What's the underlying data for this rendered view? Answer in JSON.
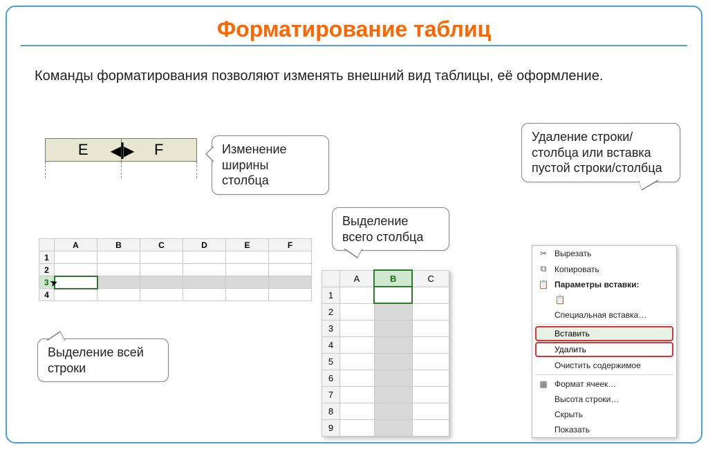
{
  "title": "Форматирование таблиц",
  "intro": "Команды форматирования позволяют изменять внешний вид таблицы, её оформление.",
  "callouts": {
    "width": "Изменение ширины столбца",
    "row": "Выделение всей строки",
    "col": "Выделение всего столбца",
    "del": "Удаление строки/столбца или вставка пустой строки/столбца"
  },
  "fig1": {
    "colE": "E",
    "colF": "F"
  },
  "fig2": {
    "cols": [
      "A",
      "B",
      "C",
      "D",
      "E",
      "F"
    ],
    "rows": [
      "1",
      "2",
      "3",
      "4"
    ],
    "selectedRow": "3"
  },
  "fig3": {
    "cols": [
      "A",
      "B",
      "C"
    ],
    "rows": [
      "1",
      "2",
      "3",
      "4",
      "5",
      "6",
      "7",
      "8",
      "9"
    ],
    "selectedCol": "B"
  },
  "contextMenu": {
    "cut": "Вырезать",
    "copy": "Копировать",
    "pasteOptionsTitle": "Параметры вставки:",
    "pasteSpecial": "Специальная вставка…",
    "insert": "Вставить",
    "delete": "Удалить",
    "clear": "Очистить содержимое",
    "formatCells": "Формат ячеек…",
    "rowHeight": "Высота строки…",
    "hide": "Скрыть",
    "show": "Показать"
  }
}
